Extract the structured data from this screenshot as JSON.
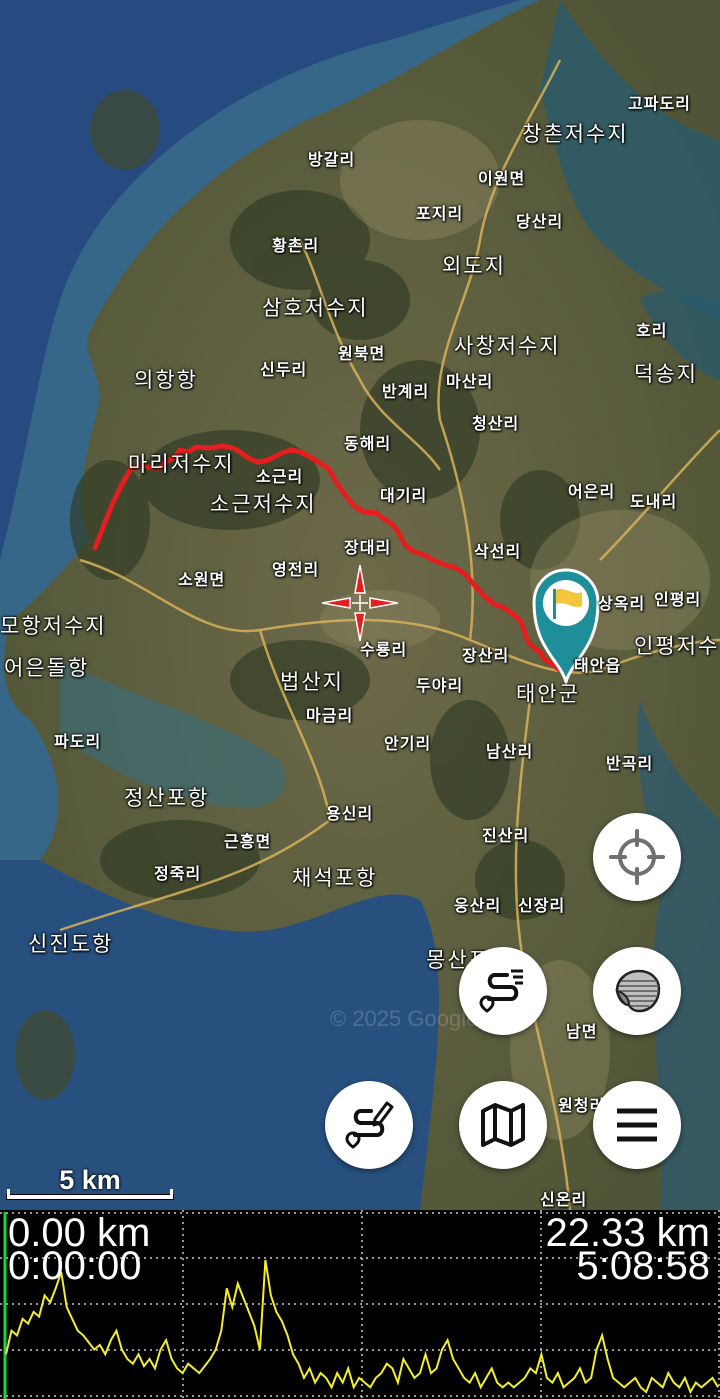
{
  "map": {
    "places": [
      {
        "id": "gopadori",
        "label": "고파도리",
        "big": false
      },
      {
        "id": "changchun",
        "label": "창촌저수지",
        "big": true
      },
      {
        "id": "banggalri",
        "label": "방갈리",
        "big": false
      },
      {
        "id": "iwonmyeon",
        "label": "이원면",
        "big": false
      },
      {
        "id": "pojiri",
        "label": "포지리",
        "big": false
      },
      {
        "id": "dangsanri",
        "label": "당산리",
        "big": false
      },
      {
        "id": "hwangchonri",
        "label": "황촌리",
        "big": false
      },
      {
        "id": "oedoji",
        "label": "외도지",
        "big": true
      },
      {
        "id": "samho",
        "label": "삼호저수지",
        "big": true
      },
      {
        "id": "horiE",
        "label": "호리",
        "big": false
      },
      {
        "id": "wonbukmyeon",
        "label": "원북면",
        "big": false
      },
      {
        "id": "sachang",
        "label": "사창저수지",
        "big": true
      },
      {
        "id": "sinduri",
        "label": "신두리",
        "big": false
      },
      {
        "id": "uihanghang",
        "label": "의항항",
        "big": true
      },
      {
        "id": "bangyeri",
        "label": "반계리",
        "big": false
      },
      {
        "id": "masanri",
        "label": "마산리",
        "big": false
      },
      {
        "id": "deoksongji",
        "label": "덕송지",
        "big": true
      },
      {
        "id": "cheongsanri",
        "label": "청산리",
        "big": false
      },
      {
        "id": "donghaeri",
        "label": "동해리",
        "big": false
      },
      {
        "id": "mali",
        "label": "마리저수지",
        "big": true
      },
      {
        "id": "sogeunri",
        "label": "소근리",
        "big": false
      },
      {
        "id": "sogeunjeo",
        "label": "소근저수지",
        "big": true
      },
      {
        "id": "daegiri",
        "label": "대기리",
        "big": false
      },
      {
        "id": "eoeunri",
        "label": "어은리",
        "big": false
      },
      {
        "id": "donaeri",
        "label": "도내리",
        "big": false
      },
      {
        "id": "saksunri",
        "label": "삭선리",
        "big": false
      },
      {
        "id": "jangdaeri",
        "label": "장대리",
        "big": false
      },
      {
        "id": "sowonmyeon",
        "label": "소원면",
        "big": false
      },
      {
        "id": "yeongjeonri",
        "label": "영전리",
        "big": false
      },
      {
        "id": "sangokri",
        "label": "상옥리",
        "big": false
      },
      {
        "id": "inpyeongri",
        "label": "인평리",
        "big": false
      },
      {
        "id": "mohang",
        "label": "모항저수지",
        "big": true
      },
      {
        "id": "inpyeongjeo",
        "label": "인평저수",
        "big": true
      },
      {
        "id": "eoeundol",
        "label": "어은돌항",
        "big": true
      },
      {
        "id": "surongri",
        "label": "수룡리",
        "big": false
      },
      {
        "id": "jangsanri",
        "label": "장산리",
        "big": false
      },
      {
        "id": "taeaneup",
        "label": "태안읍",
        "big": false
      },
      {
        "id": "beopsanji",
        "label": "법산지",
        "big": true
      },
      {
        "id": "duyari",
        "label": "두야리",
        "big": false
      },
      {
        "id": "taeangun",
        "label": "태안군",
        "big": true
      },
      {
        "id": "magumri",
        "label": "마금리",
        "big": false
      },
      {
        "id": "padori",
        "label": "파도리",
        "big": false
      },
      {
        "id": "angiri",
        "label": "안기리",
        "big": false
      },
      {
        "id": "namsanri",
        "label": "남산리",
        "big": false
      },
      {
        "id": "bangokri",
        "label": "반곡리",
        "big": false
      },
      {
        "id": "jeongsanpo",
        "label": "정산포항",
        "big": true
      },
      {
        "id": "yongsinri",
        "label": "용신리",
        "big": false
      },
      {
        "id": "jinsanri",
        "label": "진산리",
        "big": false
      },
      {
        "id": "geunheung",
        "label": "근흥면",
        "big": false
      },
      {
        "id": "jeongjukri",
        "label": "정죽리",
        "big": false
      },
      {
        "id": "chaeseok",
        "label": "채석포항",
        "big": true
      },
      {
        "id": "ungsanri",
        "label": "웅산리",
        "big": false
      },
      {
        "id": "sinjangri",
        "label": "신장리",
        "big": false
      },
      {
        "id": "sinjindo",
        "label": "신진도항",
        "big": true
      },
      {
        "id": "mongsan",
        "label": "몽산포항",
        "big": true
      },
      {
        "id": "nammyeon",
        "label": "남면",
        "big": false
      },
      {
        "id": "wonchong",
        "label": "원청리",
        "big": false
      },
      {
        "id": "sinonri",
        "label": "신온리",
        "big": false
      }
    ],
    "watermark": "© 2025 Google",
    "colors": {
      "route": "#e41e1e",
      "marker": "#1e8e98",
      "flag": "#f4c43a",
      "profile_line": "#f3ee2a",
      "start_line": "#22d13a"
    }
  },
  "scale": {
    "label": "5 km"
  },
  "controls": {
    "locate": "crosshair-icon",
    "layers": "layers-icon",
    "route_list": "route-list-icon",
    "route_edit": "route-edit-icon",
    "map": "map-icon",
    "menu": "menu-icon"
  },
  "profile": {
    "start_distance": "0.00 km",
    "start_time": "0:00:00",
    "end_distance": "22.33 km",
    "end_time": "5:08:58",
    "elevation": [
      20,
      30,
      28,
      35,
      33,
      38,
      36,
      45,
      42,
      48,
      55,
      40,
      35,
      30,
      28,
      25,
      22,
      24,
      20,
      26,
      30,
      22,
      18,
      16,
      20,
      15,
      18,
      14,
      22,
      26,
      18,
      14,
      12,
      16,
      14,
      12,
      15,
      18,
      22,
      30,
      48,
      40,
      50,
      44,
      38,
      32,
      22,
      60,
      45,
      38,
      34,
      28,
      20,
      16,
      10,
      14,
      8,
      12,
      10,
      6,
      12,
      8,
      14,
      6,
      10,
      8,
      6,
      10,
      12,
      16,
      14,
      8,
      18,
      14,
      10,
      12,
      20,
      12,
      14,
      22,
      26,
      18,
      14,
      10,
      8,
      12,
      6,
      10,
      14,
      8,
      6,
      8,
      6,
      8,
      10,
      14,
      12,
      20,
      10,
      8,
      12,
      6,
      8,
      10,
      14,
      8,
      10,
      22,
      28,
      18,
      10,
      8,
      6,
      8,
      10,
      6,
      4,
      10,
      8,
      6,
      12,
      8,
      6,
      10,
      4,
      8,
      6,
      8,
      10,
      6
    ]
  }
}
